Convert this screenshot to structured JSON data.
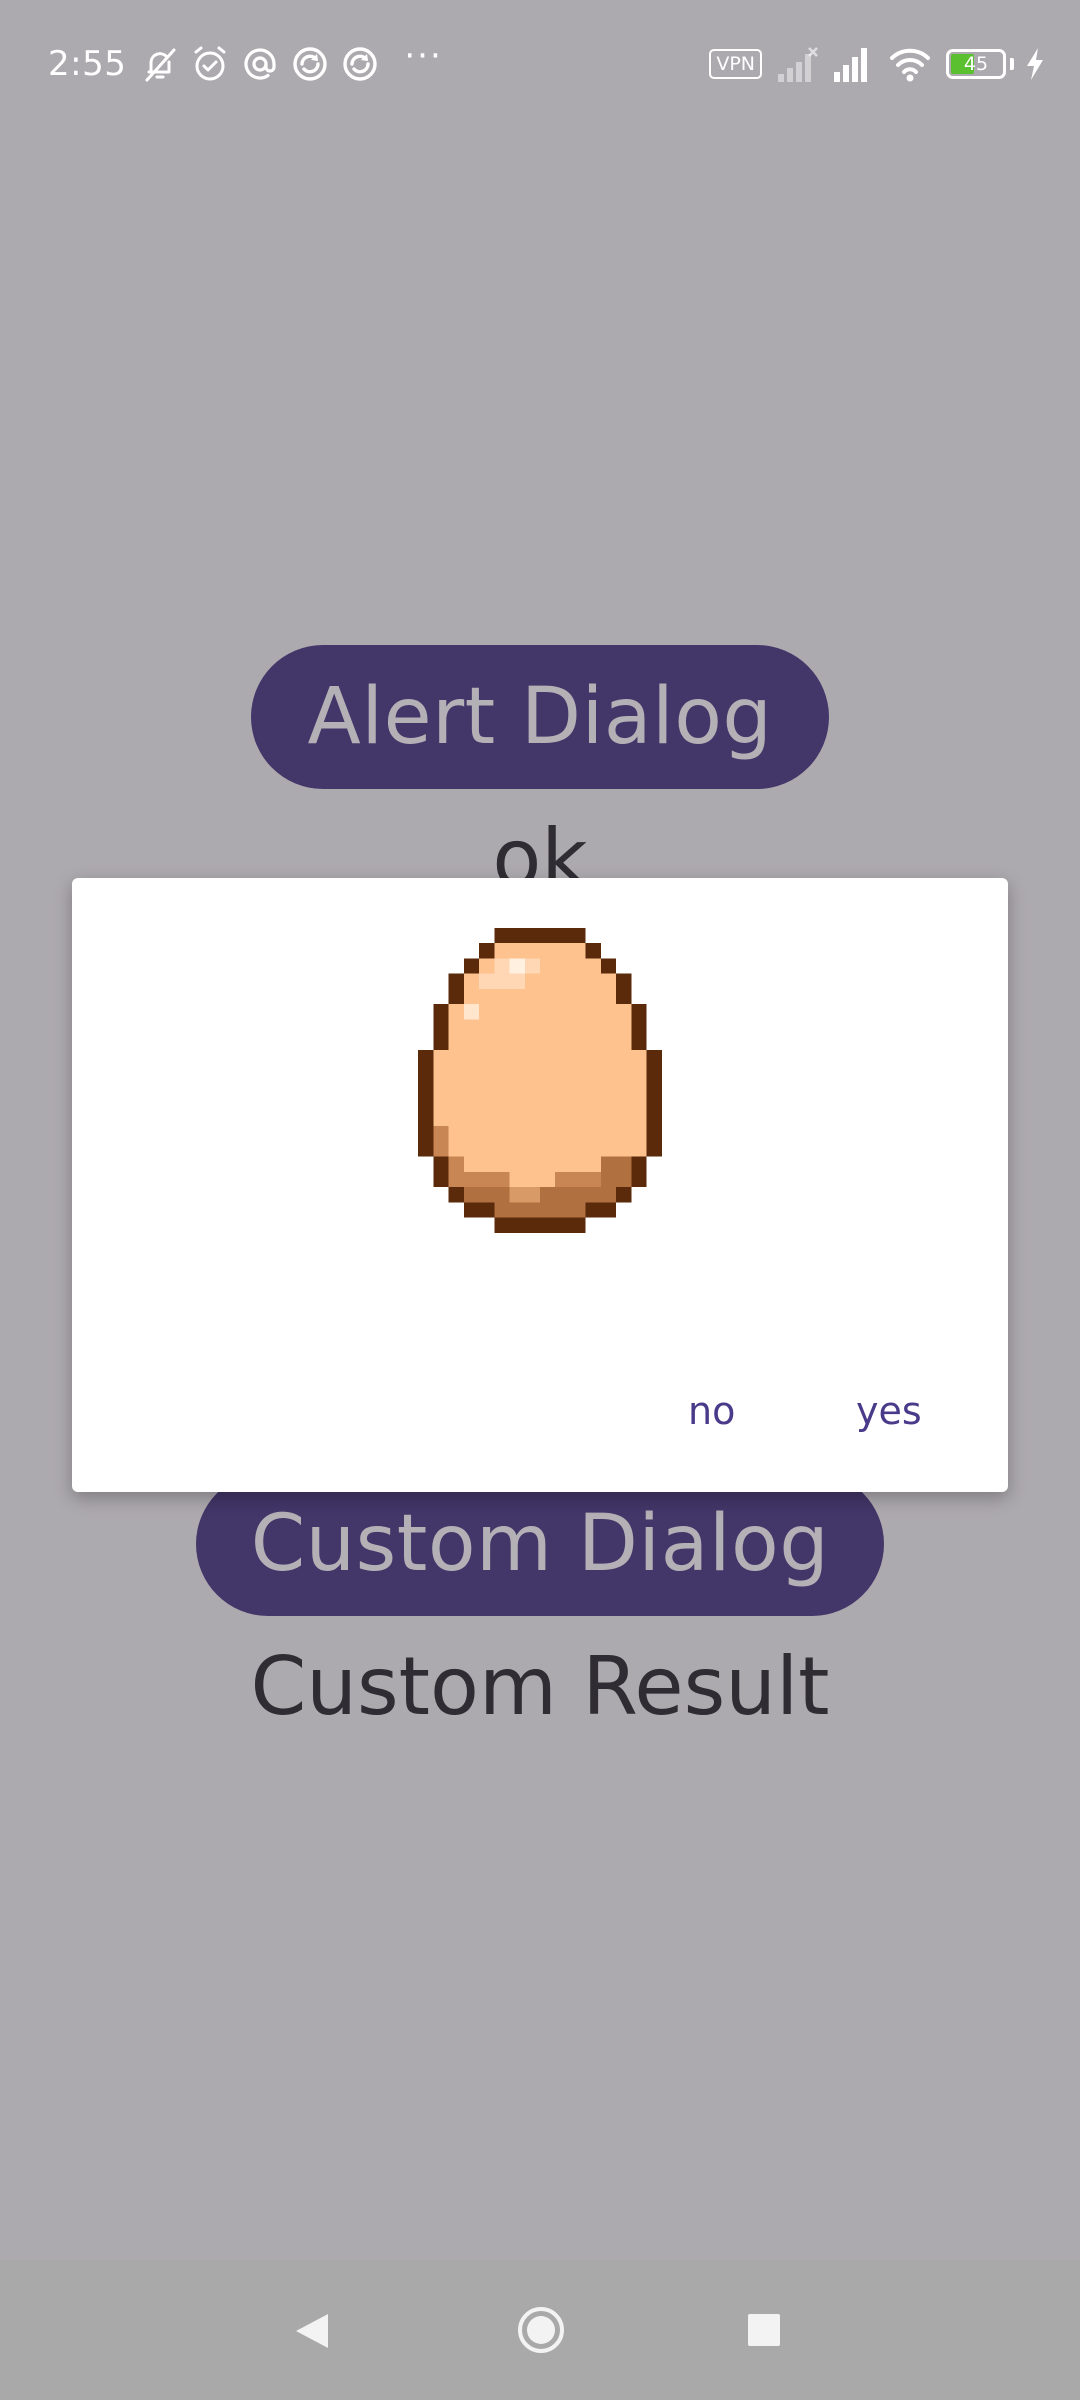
{
  "status_bar": {
    "time": "2:55",
    "left_icons": [
      "bell-off-icon",
      "alarm-icon",
      "at-sign-icon",
      "sync-icon",
      "sync-icon",
      "overflow-dots-icon"
    ],
    "overflow": "···",
    "vpn_label": "VPN",
    "battery_level": "45",
    "battery_fraction": 0.45,
    "charging": true
  },
  "main": {
    "alert_button_label": "Alert Dialog",
    "alert_result": "ok",
    "custom_button_label": "Custom Dialog",
    "custom_result": "Custom Result"
  },
  "dialog": {
    "image_icon": "egg-image",
    "negative_label": "no",
    "positive_label": "yes"
  },
  "nav_bar": {
    "icons": [
      "back-icon",
      "home-icon",
      "recents-icon"
    ]
  },
  "colors": {
    "background_scrim": "#adaaaf",
    "button_bg": "#433669",
    "button_text": "#b3b0b6",
    "dialog_action": "#4a3a8a",
    "battery_green": "#5ac02f"
  }
}
